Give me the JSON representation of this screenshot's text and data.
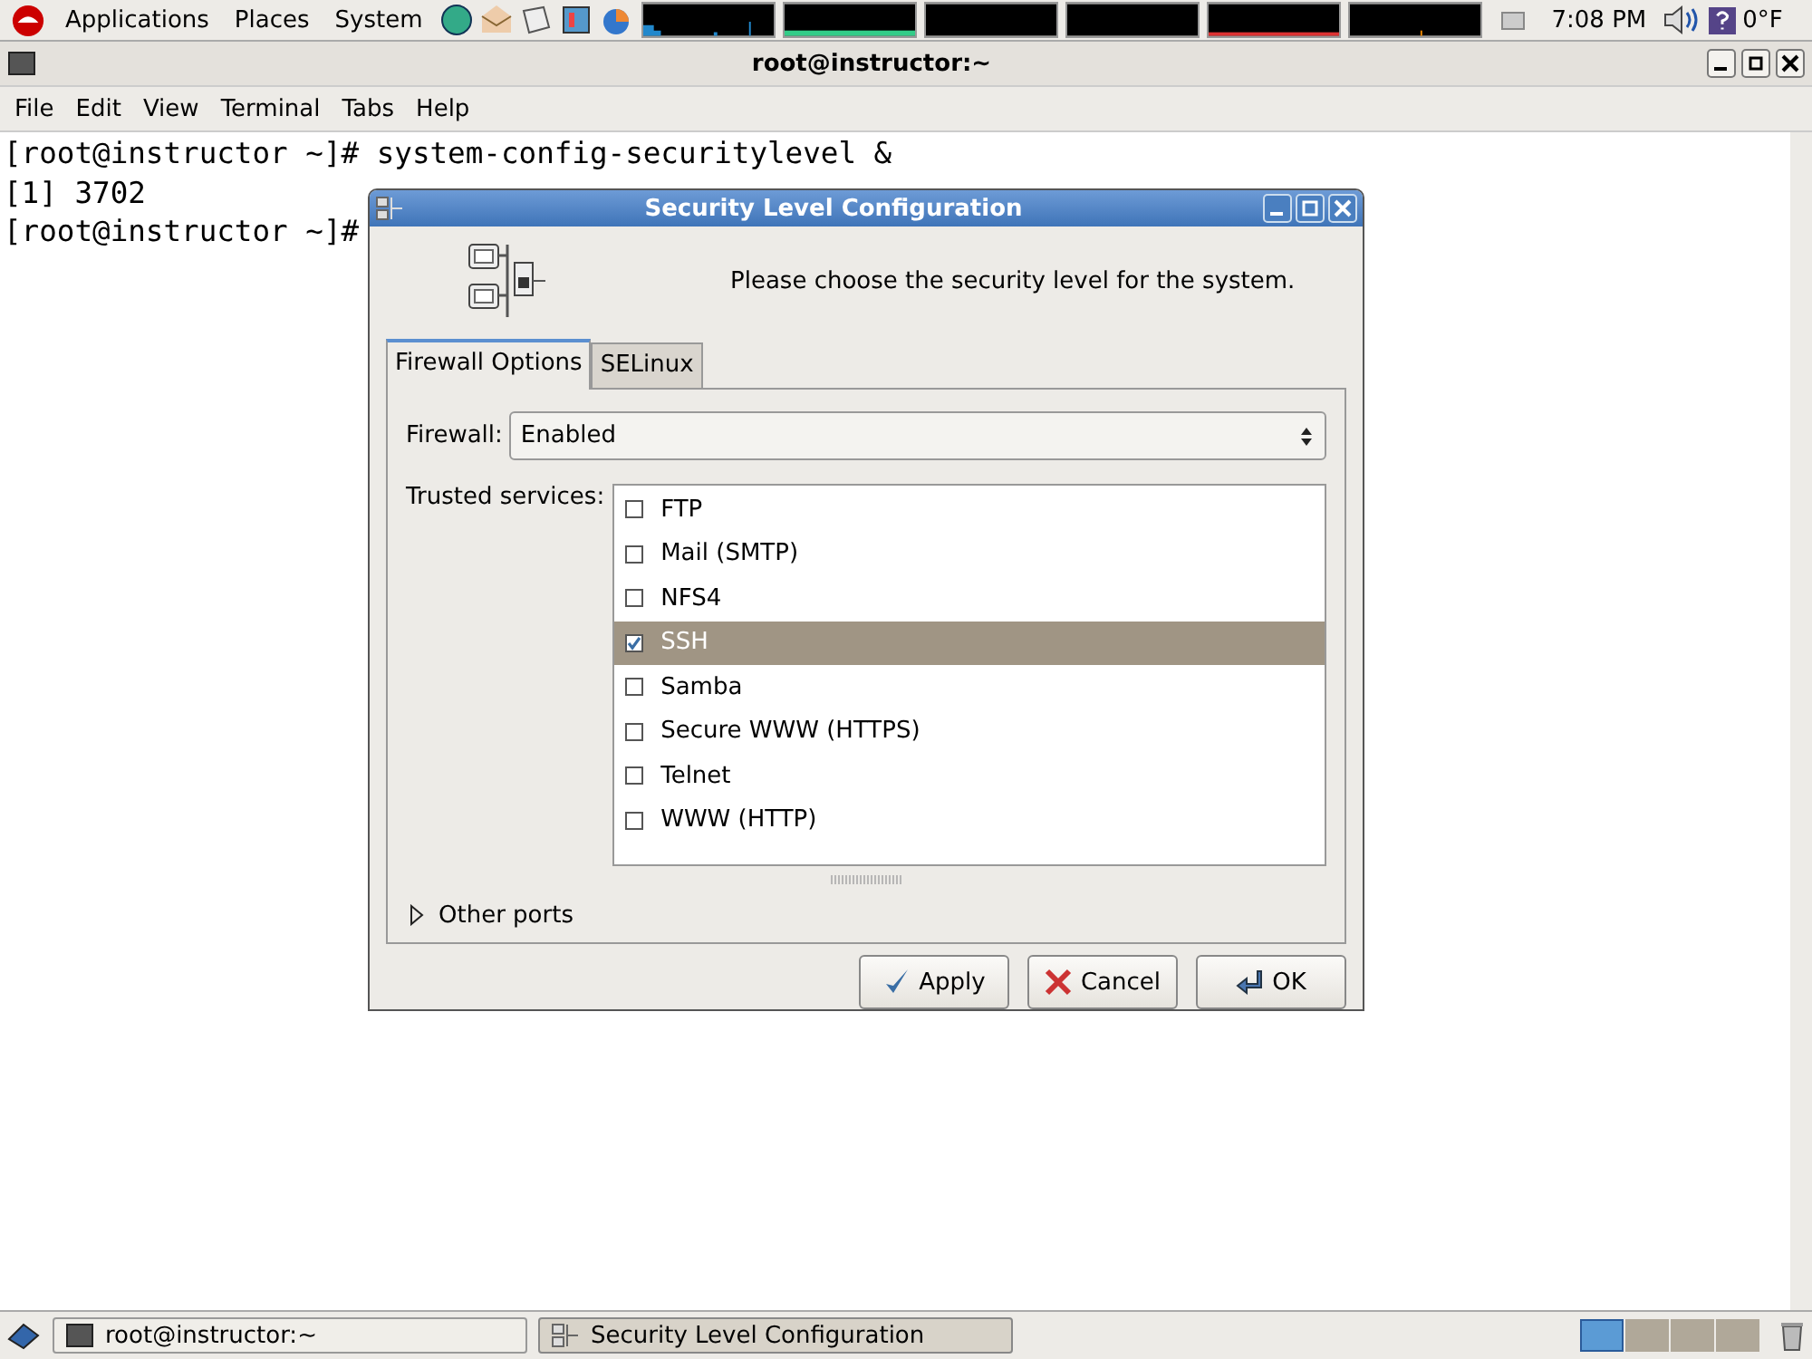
{
  "top_panel": {
    "menus": [
      "Applications",
      "Places",
      "System"
    ],
    "clock": "7:08 PM",
    "weather": "0°F"
  },
  "terminal": {
    "title": "root@instructor:~",
    "menu": [
      "File",
      "Edit",
      "View",
      "Terminal",
      "Tabs",
      "Help"
    ],
    "lines": [
      "[root@instructor ~]# system-config-securitylevel &",
      "[1] 3702",
      "[root@instructor ~]#"
    ]
  },
  "dialog": {
    "title": "Security Level Configuration",
    "message": "Please choose the security level for the system.",
    "tabs": [
      {
        "label": "Firewall Options",
        "selected": true
      },
      {
        "label": "SELinux",
        "selected": false
      }
    ],
    "firewall": {
      "label": "Firewall:",
      "value": "Enabled"
    },
    "trusted_label": "Trusted services:",
    "services": [
      {
        "label": "FTP",
        "checked": false,
        "selected": false
      },
      {
        "label": "Mail (SMTP)",
        "checked": false,
        "selected": false
      },
      {
        "label": "NFS4",
        "checked": false,
        "selected": false
      },
      {
        "label": "SSH",
        "checked": true,
        "selected": true
      },
      {
        "label": "Samba",
        "checked": false,
        "selected": false
      },
      {
        "label": "Secure WWW (HTTPS)",
        "checked": false,
        "selected": false
      },
      {
        "label": "Telnet",
        "checked": false,
        "selected": false
      },
      {
        "label": "WWW (HTTP)",
        "checked": false,
        "selected": false
      }
    ],
    "other_ports": {
      "label": "Other ports",
      "expanded": false
    },
    "buttons": [
      {
        "kind": "apply",
        "label": "Apply"
      },
      {
        "kind": "cancel",
        "label": "Cancel"
      },
      {
        "kind": "ok",
        "label": "OK"
      }
    ]
  },
  "taskbar": {
    "tasks": [
      {
        "kind": "terminal",
        "label": "root@instructor:~",
        "selected": false
      },
      {
        "kind": "dialog",
        "label": "Security Level Configuration",
        "selected": true
      }
    ],
    "workspaces": [
      {
        "selected": true
      },
      {
        "selected": false
      },
      {
        "selected": false
      },
      {
        "selected": false
      }
    ]
  }
}
